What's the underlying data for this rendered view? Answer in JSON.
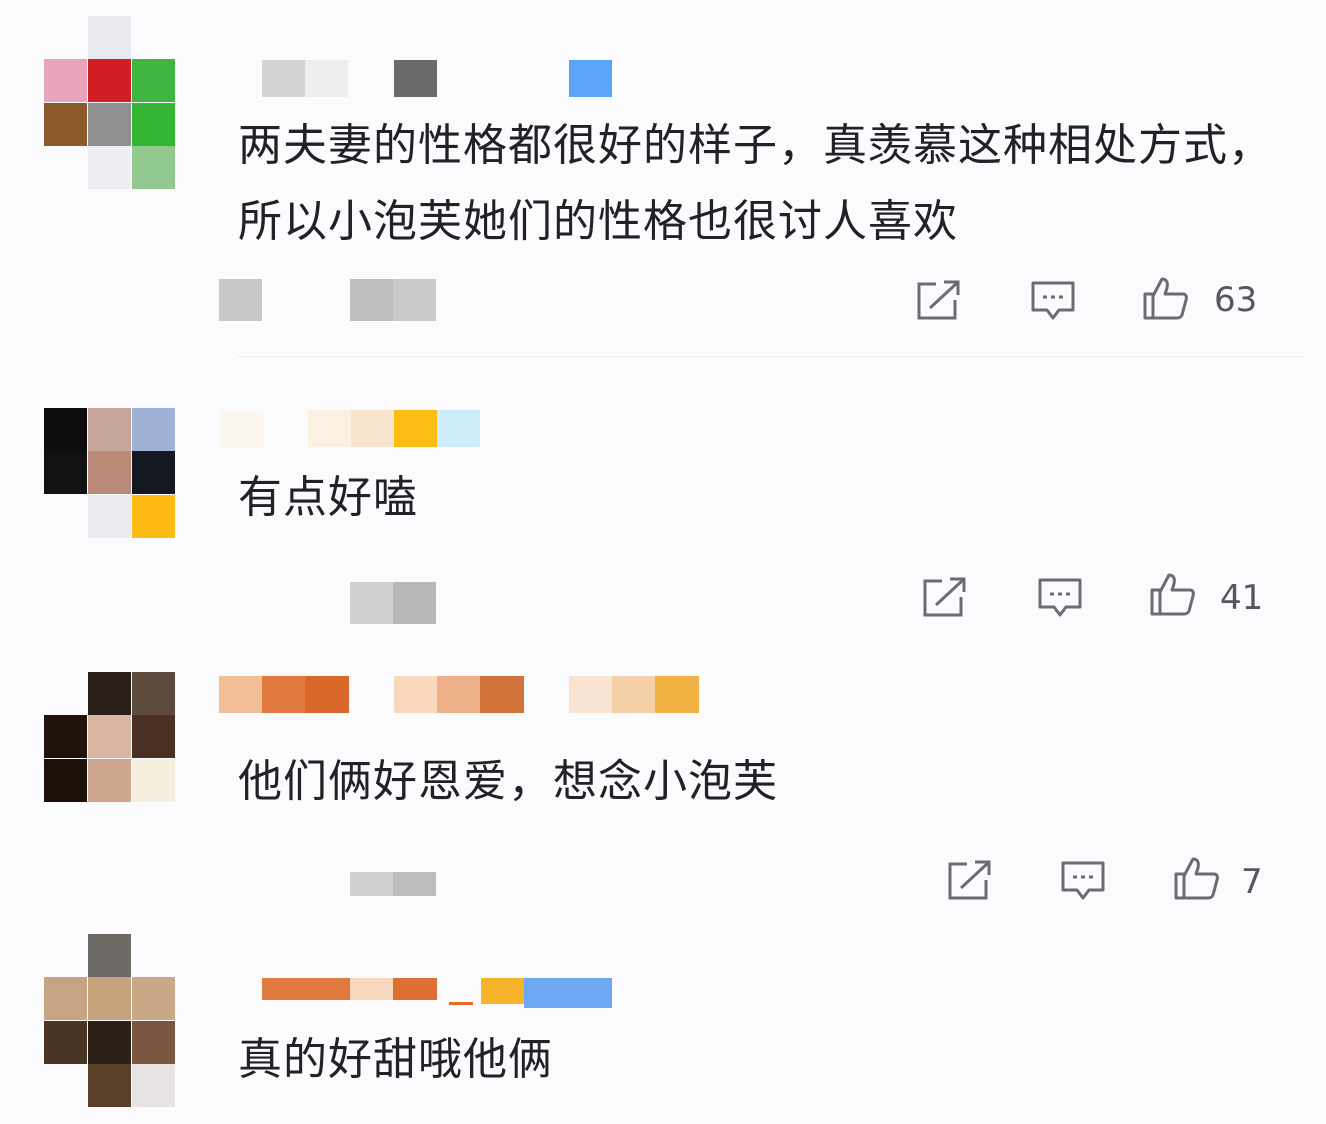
{
  "comments": [
    {
      "text": "两夫妻的性格都很好的样子，真羡慕这种相处方式，所以小泡芙她们的性格也很讨人喜欢",
      "likes": "63",
      "avatar_colors": [
        "#e8e8ef",
        "#e9a4bb",
        "#d11d24",
        "#3fb63f",
        "#8b5a2b",
        "#8f8f8f",
        "#34b534",
        "#eeeef3",
        "#92c98f"
      ],
      "name_colors": [
        "#d4d4d4",
        "#eeeeee",
        "#6a6a6a",
        "#5ba4f7"
      ],
      "meta_colors": [
        "#c8c8c8",
        "#bfbfbf",
        "#cacaca"
      ]
    },
    {
      "text": "有点好嗑",
      "likes": "41",
      "avatar_colors": [
        "#0e0e10",
        "#c7a79a",
        "#9fb2d6",
        "#111114",
        "#b98a77",
        "#141820",
        "#ebebf0",
        "#fcba12"
      ],
      "name_colors": [
        "#fbf7f0",
        "#fbf0e1",
        "#f9e4cf",
        "#fbbd14",
        "#cdeef8"
      ],
      "meta_colors": [
        "#cfcfcf",
        "#b8b8b8"
      ]
    },
    {
      "text": "他们俩好恩爱，想念小泡芙",
      "likes": "7",
      "avatar_colors": [
        "#2a1e18",
        "#5c4a3c",
        "#22120c",
        "#d9b6a2",
        "#4a3022",
        "#20100a",
        "#cfa68f",
        "#f5efe0"
      ],
      "name_colors": [
        "#f2be96",
        "#e07a3e",
        "#d9682a",
        "#f9d8bd",
        "#eeb088",
        "#d2743a",
        "#f9e4d1",
        "#f5cfa6",
        "#efb243"
      ],
      "meta_colors": [
        "#cfcfcf",
        "#bdbdbd"
      ]
    },
    {
      "text": "真的好甜哦他俩",
      "likes": "",
      "avatar_colors": [
        "#6d6a66",
        "#c5a383",
        "#c8a27c",
        "#c9a888",
        "#4a3424",
        "#2b2016",
        "#7a5540",
        "#5a4028",
        "#e8e4e4"
      ],
      "name_colors": [
        "#e07a3e",
        "#f8d8bd",
        "#dd6f30",
        "#e86a26",
        "#f6b42a",
        "#6ea8f2"
      ],
      "meta_colors": []
    }
  ],
  "icons": {
    "share": "share-icon",
    "reply": "comment-icon",
    "like": "thumbs-up-icon"
  }
}
